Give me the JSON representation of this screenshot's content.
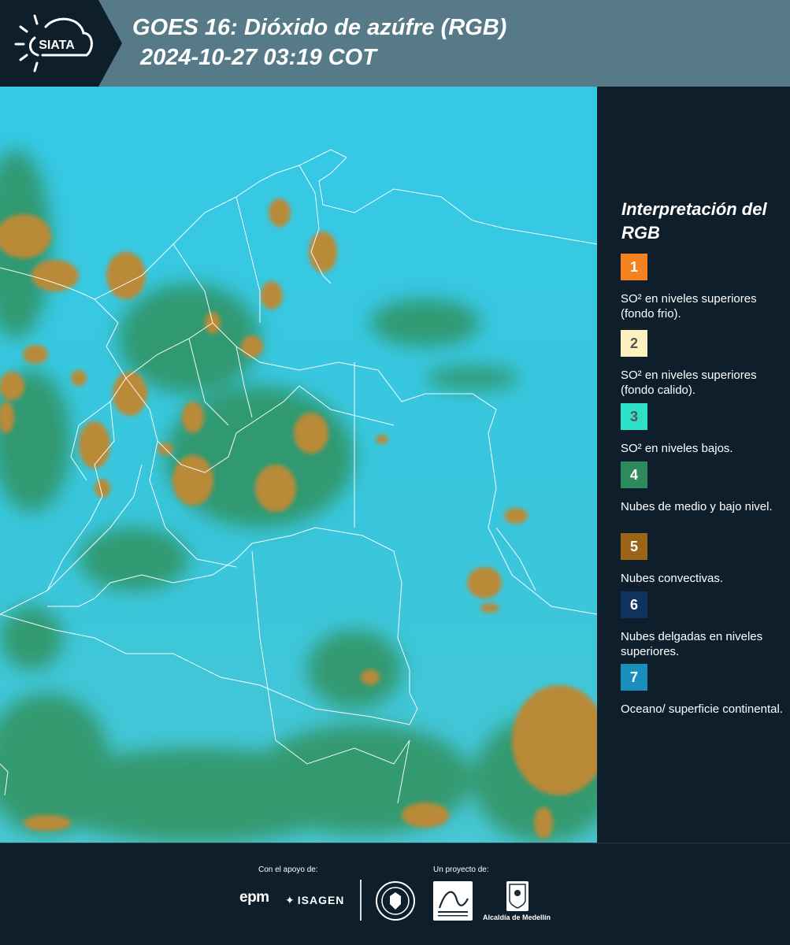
{
  "header": {
    "logo_text": "SIATA",
    "title": "GOES 16: Dióxido de azúfre (RGB)",
    "subtitle": " 2024-10-27 03:19 COT"
  },
  "legend": {
    "title": "Interpretación del RGB",
    "items": [
      {
        "number": "1",
        "label": "SO² en niveles superiores (fondo frio).",
        "color": "#f58220"
      },
      {
        "number": "2",
        "label": "SO² en niveles superiores (fondo calido).",
        "color": "#fcf2c0"
      },
      {
        "number": "3",
        "label": "SO² en niveles bajos.",
        "color": "#2ee0c8"
      },
      {
        "number": "4",
        "label": "Nubes de medio y bajo nivel.",
        "color": "#2e8a5c"
      },
      {
        "number": "5",
        "label": "Nubes convectivas.",
        "color": "#9a6516"
      },
      {
        "number": "6",
        "label": "Nubes delgadas en niveles superiores.",
        "color": "#10335e"
      },
      {
        "number": "7",
        "label": "Oceano/ superficie continental.",
        "color": "#1a8fbd"
      }
    ]
  },
  "footer": {
    "support_label": "Con el apoyo de:",
    "project_label": "Un proyecto de:",
    "sponsor_1": "epm",
    "sponsor_2": "ISAGEN",
    "partner_3": "Alcaldía de Medellín"
  },
  "colors": {
    "header_bg": "#567a87",
    "panel_bg": "#0e1f2b",
    "sky": "#33c4df",
    "convective": "#b08430",
    "midlevel": "#2a8448",
    "border_line": "#ffffff"
  }
}
